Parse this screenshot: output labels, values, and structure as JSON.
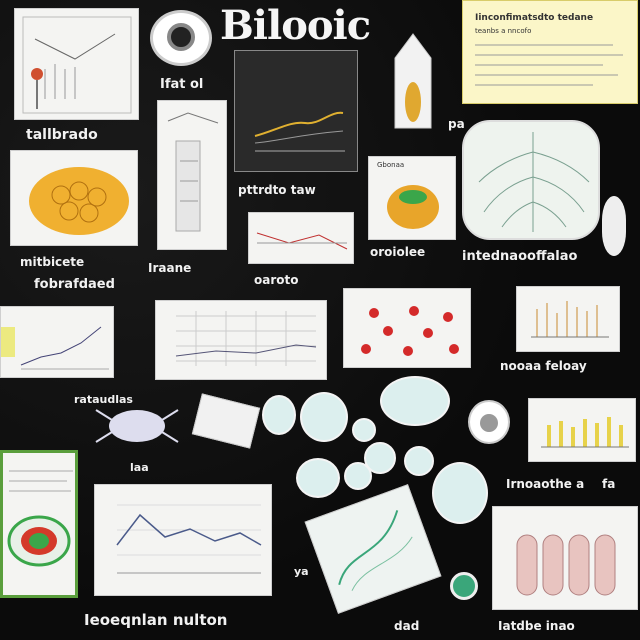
{
  "title": "Bilooic",
  "labels": {
    "l1": "tallbrado",
    "l2": "Ifat ol",
    "l3": "pa",
    "l4": "mitbicete",
    "l5": "fobrafdaed",
    "l6": "Iraane",
    "l7": "pttrdto taw",
    "l8": "oaroto",
    "l9": "oroiolee",
    "l10": "intednaooffalao",
    "l11": "nooaa feloay",
    "l12": "rataudlas",
    "l13": "Irnoaothe a",
    "l14": "Ieoeqnlan nulton",
    "l15": "dad",
    "l16": "Iatdbe inao",
    "l17": "fa",
    "l18": "laa",
    "l19": "ya"
  },
  "notes": {
    "yellow_heading": "Iinconfimatsdto  tedane",
    "yellow_sub": "teanbs a nncofo",
    "small_card_heading": "Gbonaa"
  },
  "colors": {
    "background": "#0b0b0b",
    "card": "#f4f4f2",
    "yellow_card": "#fbf6c8",
    "accent_orange": "#e8a52a",
    "accent_red": "#d42a2a",
    "accent_green": "#3aa64a"
  }
}
